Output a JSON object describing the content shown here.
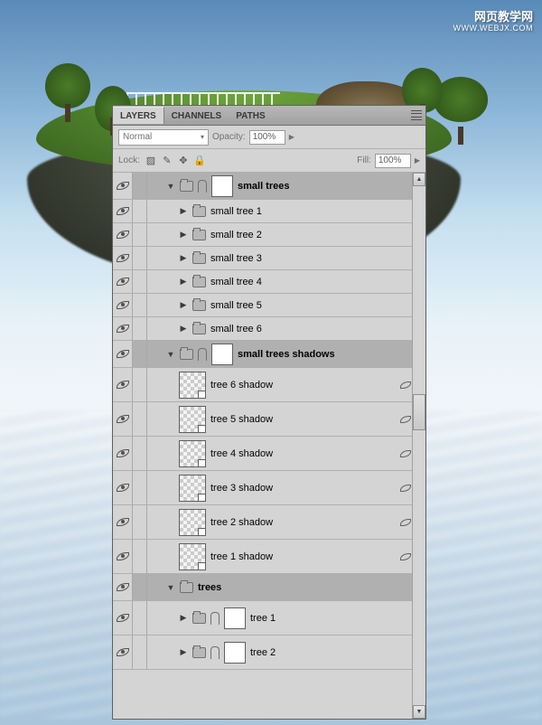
{
  "watermark": {
    "title": "网页教学网",
    "url": "WWW.WEBJX.COM"
  },
  "panel": {
    "tabs": {
      "layers": "LAYERS",
      "channels": "CHANNELS",
      "paths": "PATHS"
    },
    "blendMode": "Normal",
    "opacityLabel": "Opacity:",
    "opacityValue": "100%",
    "lockLabel": "Lock:",
    "fillLabel": "Fill:",
    "fillValue": "100%"
  },
  "layers": {
    "group_small_trees": "small trees",
    "small_tree_1": "small tree 1",
    "small_tree_2": "small tree 2",
    "small_tree_3": "small tree 3",
    "small_tree_4": "small tree 4",
    "small_tree_5": "small tree 5",
    "small_tree_6": "small tree 6",
    "group_small_trees_shadows": "small trees shadows",
    "tree_6_shadow": "tree 6 shadow",
    "tree_5_shadow": "tree 5 shadow",
    "tree_4_shadow": "tree 4 shadow",
    "tree_3_shadow": "tree 3 shadow",
    "tree_2_shadow": "tree 2 shadow",
    "tree_1_shadow": "tree 1 shadow",
    "group_trees": "trees",
    "tree_1": "tree 1",
    "tree_2": "tree 2"
  }
}
